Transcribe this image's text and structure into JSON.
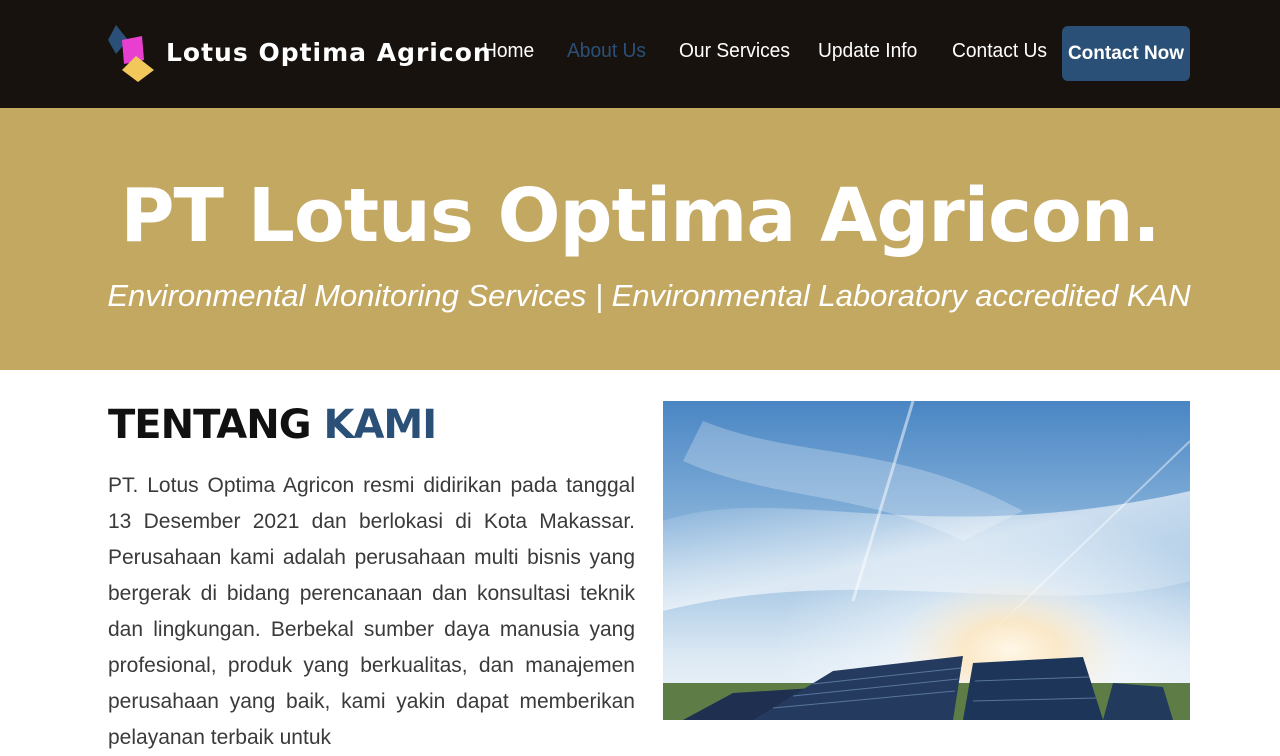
{
  "header": {
    "brand": "Lotus Optima Agricon",
    "logo_icon": "lotus-logo-icon",
    "nav": [
      {
        "label": "Home",
        "active": false
      },
      {
        "label": "About Us",
        "active": true
      },
      {
        "label": "Our Services",
        "active": false
      },
      {
        "label": "Update Info",
        "active": false
      },
      {
        "label": "Contact Us",
        "active": false
      }
    ],
    "cta_label": "Contact Now"
  },
  "banner": {
    "title": "PT Lotus Optima Agricon.",
    "subtitle": "Environmental Monitoring Services | Environmental Laboratory accredited KAN"
  },
  "about": {
    "title_part1": "TENTANG",
    "title_part2": "KAMI",
    "text": "PT. Lotus Optima Agricon resmi didirikan pada tanggal 13 Desember 2021 dan berlokasi di Kota Makassar. Perusahaan kami adalah perusahaan multi bisnis yang bergerak di bidang perencanaan dan konsultasi teknik dan lingkungan. Berbekal sumber daya manusia yang profesional, produk yang berkualitas, dan manajemen perusahaan yang baik, kami yakin dapat memberikan pelayanan terbaik untuk"
  },
  "colors": {
    "header_bg": "#17120e",
    "banner_bg": "#c3a862",
    "accent": "#2a5078"
  }
}
